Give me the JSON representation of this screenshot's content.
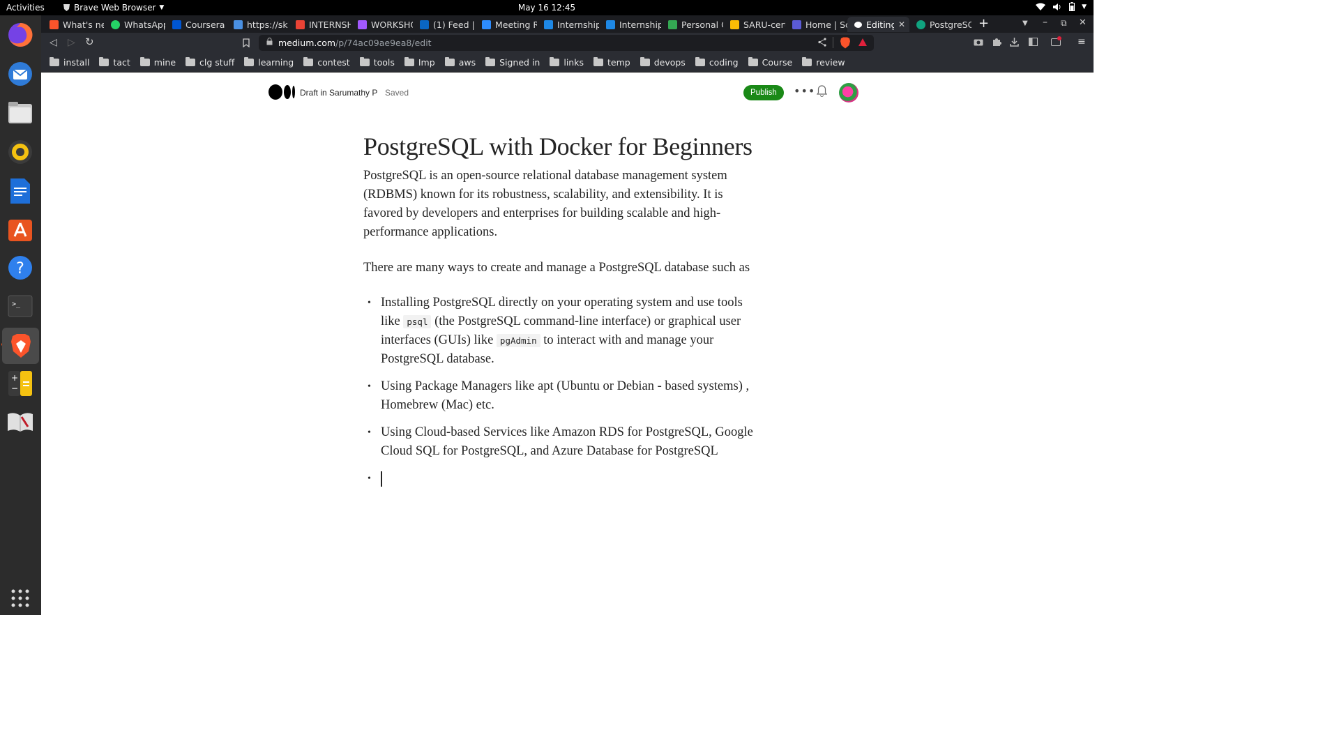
{
  "system": {
    "activities": "Activities",
    "app_menu": "Brave Web Browser",
    "clock": "May 16  12:45"
  },
  "dock": [
    "firefox-icon",
    "thunderbird-icon",
    "files-icon",
    "rhythmbox-icon",
    "writer-icon",
    "app-center-icon",
    "help-icon",
    "terminal-icon",
    "brave-icon",
    "calculator-icon",
    "book-icon",
    "show-apps-icon"
  ],
  "tabs": [
    {
      "title": "What's ne",
      "color": "#fb542b"
    },
    {
      "title": "WhatsApp",
      "color": "#25d366"
    },
    {
      "title": "Coursera |",
      "color": "#0056d2"
    },
    {
      "title": "https://sk",
      "color": "#4a90e2"
    },
    {
      "title": "INTERNSH",
      "color": "#ea4335"
    },
    {
      "title": "WORKSHO",
      "color": "#a259ff"
    },
    {
      "title": "(1) Feed | L",
      "color": "#0a66c2"
    },
    {
      "title": "Meeting R",
      "color": "#2d8cff"
    },
    {
      "title": "Internship",
      "color": "#1e88e5"
    },
    {
      "title": "Internship",
      "color": "#1e88e5"
    },
    {
      "title": "Personal C",
      "color": "#34a853"
    },
    {
      "title": "SARU-cert",
      "color": "#fbbc05"
    },
    {
      "title": "Home | Sca",
      "color": "#5b5bd6"
    },
    {
      "title": "Editing",
      "color": "#ffffff"
    },
    {
      "title": "PostgreSC",
      "color": "#10a37f"
    }
  ],
  "address": {
    "host": "medium.com",
    "path": "/p/74ac09ae9ea8/edit"
  },
  "bookmarks": [
    "install",
    "tact",
    "mine",
    "clg stuff",
    "learning",
    "contest",
    "tools",
    "Imp",
    "aws",
    "Signed in",
    "links",
    "temp",
    "devops",
    "coding",
    "Course",
    "review"
  ],
  "medium": {
    "draft": "Draft in Sarumathy P",
    "saved": "Saved",
    "publish": "Publish",
    "more": "•••"
  },
  "article": {
    "title": "PostgreSQL with Docker for Beginners",
    "p1": "PostgreSQL is an open-source relational database management system (RDBMS) known for its robustness, scalability, and extensibility. It is favored by developers and enterprises for building scalable and high-performance applications.",
    "p2": "There are many ways to create and manage a PostgreSQL database such as",
    "li1_a": "Installing PostgreSQL directly on your operating system and use tools like",
    "li1_code1": "psql",
    "li1_b": "(the PostgreSQL command-line interface) or graphical user interfaces (GUIs) like",
    "li1_code2": "pgAdmin",
    "li1_c": "to interact with and manage your PostgreSQL database.",
    "li2": "Using Package Managers like apt (Ubuntu or Debian - based systems) , Homebrew (Mac) etc.",
    "li3": "Using Cloud-based Services like Amazon RDS for PostgreSQL, Google Cloud SQL for PostgreSQL, and Azure Database for PostgreSQL"
  }
}
